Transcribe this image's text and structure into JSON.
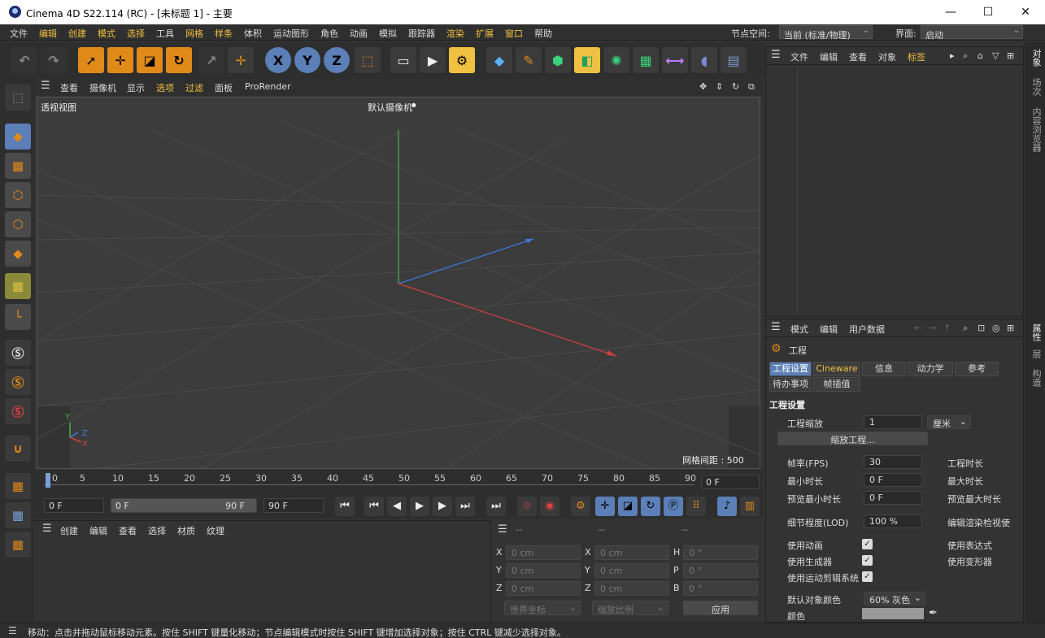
{
  "window": {
    "title": "Cinema 4D S22.114 (RC) - [未标题 1] - 主要",
    "minimize": "—",
    "maximize": "☐",
    "close": "✕"
  },
  "menu": {
    "items": [
      "文件",
      "编辑",
      "创建",
      "模式",
      "选择",
      "工具",
      "网格",
      "样条",
      "体积",
      "运动图形",
      "角色",
      "动画",
      "模拟",
      "跟踪器",
      "渲染",
      "扩展",
      "窗口",
      "帮助"
    ],
    "nodespace_label": "节点空间:",
    "nodespace_value": "当前 (标准/物理)",
    "layout_label": "界面:",
    "layout_value": "启动"
  },
  "viewport": {
    "menu": [
      "查看",
      "摄像机",
      "显示",
      "选项",
      "过滤",
      "面板",
      "ProRender"
    ],
    "view_name": "透视视图",
    "camera": "默认摄像机",
    "grid_spacing": "网格间距 : 500 cm",
    "axis_y": "Y",
    "axis_z": "Z",
    "axis_x": "X"
  },
  "timeline": {
    "ticks": [
      "0",
      "5",
      "10",
      "15",
      "20",
      "25",
      "30",
      "35",
      "40",
      "45",
      "50",
      "55",
      "60",
      "65",
      "70",
      "75",
      "80",
      "85",
      "90"
    ],
    "current_frame": "0 F"
  },
  "transport": {
    "start": "0 F",
    "range_start": "0 F",
    "range_end": "90 F",
    "end": "90 F"
  },
  "materials": {
    "menu": [
      "创建",
      "编辑",
      "查看",
      "选择",
      "材质",
      "纹理"
    ]
  },
  "coords": {
    "headers": [
      "--",
      "--",
      "--"
    ],
    "rows": [
      {
        "a": "X",
        "av": "0 cm",
        "b": "X",
        "bv": "0 cm",
        "c": "H",
        "cv": "0 °"
      },
      {
        "a": "Y",
        "av": "0 cm",
        "b": "Y",
        "bv": "0 cm",
        "c": "P",
        "cv": "0 °"
      },
      {
        "a": "Z",
        "av": "0 cm",
        "b": "Z",
        "bv": "0 cm",
        "c": "B",
        "cv": "0 °"
      }
    ],
    "world": "世界坐标",
    "scale": "缩放比例",
    "apply": "应用"
  },
  "objects": {
    "menu": [
      "文件",
      "编辑",
      "查看",
      "对象",
      "标签"
    ]
  },
  "attributes": {
    "menu": [
      "模式",
      "编辑",
      "用户数据"
    ],
    "object": "工程",
    "tabs_row1": [
      "工程设置",
      "Cineware",
      "信息",
      "动力学",
      "参考"
    ],
    "tabs_row2": [
      "待办事项",
      "帧插值"
    ],
    "section": "工程设置",
    "scale_label": "工程缩放",
    "scale_value": "1",
    "scale_unit": "厘米",
    "scale_button": "缩放工程...",
    "fps_label": "帧率(FPS)",
    "fps_value": "30",
    "project_time_label": "工程时长",
    "min_time_label": "最小时长",
    "min_time_value": "0 F",
    "max_time_label": "最大时长",
    "preview_min_label": "预览最小时长",
    "preview_min_value": "0 F",
    "preview_max_label": "预览最大时长",
    "lod_label": "细节程度(LOD)",
    "lod_value": "100 %",
    "render_lod_label": "编辑渲染检视使",
    "use_anim_label": "使用动画",
    "use_expr_label": "使用表达式",
    "use_gen_label": "使用生成器",
    "use_deform_label": "使用变形器",
    "use_motion_label": "使用运动剪辑系统",
    "default_color_label": "默认对象颜色",
    "default_color_value": "60% 灰色",
    "color_label": "颜色"
  },
  "right_tabs": [
    "对象",
    "场次",
    "内容浏览器"
  ],
  "right_tabs_lower": [
    "属性",
    "层",
    "构造"
  ],
  "status": "移动：点击并拖动鼠标移动元素。按住 SHIFT 键量化移动；节点编辑模式时按住 SHIFT 键增加选择对象；按住 CTRL 键减少选择对象。",
  "colors": {
    "accent": "#5b7fb6",
    "orange": "#e08a1a",
    "menu_highlight": "#f0c040"
  }
}
